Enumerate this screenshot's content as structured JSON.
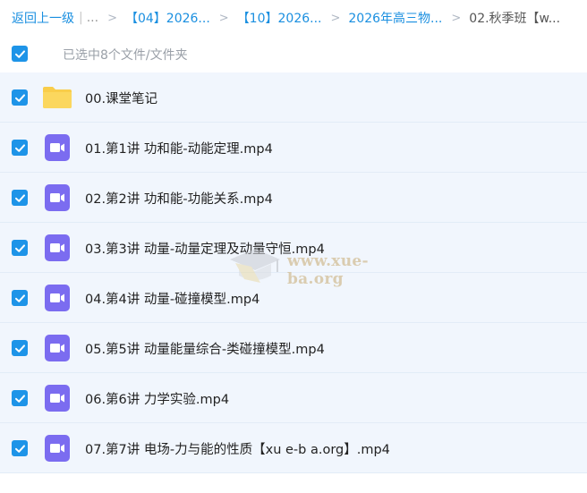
{
  "breadcrumb": {
    "back_label": "返回上一级",
    "ellipsis": "...",
    "items": [
      "【04】2026...",
      "【10】2026...",
      "2026年高三物...",
      "02.秋季班【w..."
    ]
  },
  "selection": {
    "summary": "已选中8个文件/文件夹"
  },
  "files": [
    {
      "name": "00.课堂笔记",
      "type": "folder",
      "checked": true
    },
    {
      "name": "01.第1讲 功和能-动能定理.mp4",
      "type": "video",
      "checked": true
    },
    {
      "name": "02.第2讲 功和能-功能关系.mp4",
      "type": "video",
      "checked": true
    },
    {
      "name": "03.第3讲 动量-动量定理及动量守恒.mp4",
      "type": "video",
      "checked": true
    },
    {
      "name": "04.第4讲 动量-碰撞模型.mp4",
      "type": "video",
      "checked": true
    },
    {
      "name": "05.第5讲 动量能量综合-类碰撞模型.mp4",
      "type": "video",
      "checked": true
    },
    {
      "name": "06.第6讲 力学实验.mp4",
      "type": "video",
      "checked": true
    },
    {
      "name": "07.第7讲 电场-力与能的性质【xu e-b a.org】.mp4",
      "type": "video",
      "checked": true
    }
  ],
  "watermark": {
    "text": "www.xue-ba.org"
  },
  "colors": {
    "accent": "#1e94e8",
    "link": "#1a8fe0",
    "row_bg": "#f1f6fd",
    "folder": "#f9cd4a",
    "video": "#7b6cf0"
  }
}
